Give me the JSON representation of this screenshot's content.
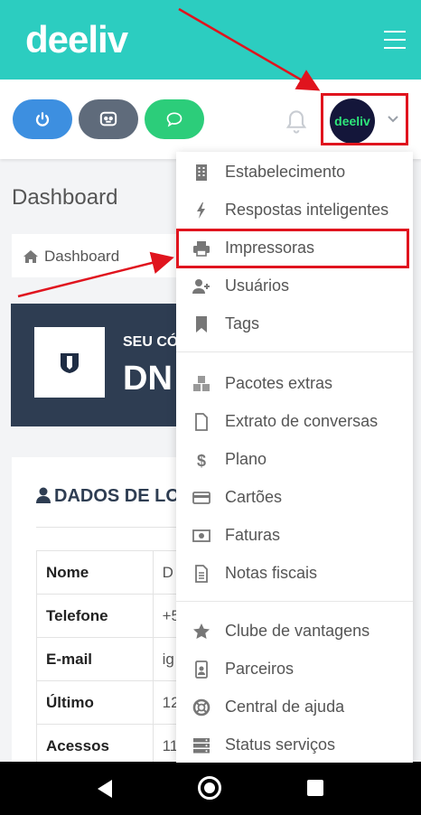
{
  "header": {
    "logo_text": "deeliv"
  },
  "user": {
    "avatar_text": "deeliv"
  },
  "page": {
    "title": "Dashboard",
    "breadcrumb": "Dashboard"
  },
  "banner": {
    "subtitle": "SEU CÓ",
    "code": "DN"
  },
  "card": {
    "title": "DADOS DE LO",
    "rows": [
      {
        "key": "Nome",
        "value": "D"
      },
      {
        "key": "Telefone",
        "value": "+5"
      },
      {
        "key": "E-mail",
        "value": "ig"
      },
      {
        "key": "Último",
        "value": "12"
      },
      {
        "key": "Acessos",
        "value": "11"
      }
    ]
  },
  "menu": {
    "items": [
      {
        "label": "Estabelecimento",
        "icon": "building-icon"
      },
      {
        "label": "Respostas inteligentes",
        "icon": "bolt-icon"
      },
      {
        "label": "Impressoras",
        "icon": "printer-icon"
      },
      {
        "label": "Usuários",
        "icon": "user-plus-icon"
      },
      {
        "label": "Tags",
        "icon": "bookmark-icon"
      },
      {
        "label": "Pacotes extras",
        "icon": "cubes-icon"
      },
      {
        "label": "Extrato de conversas",
        "icon": "file-icon"
      },
      {
        "label": "Plano",
        "icon": "dollar-icon"
      },
      {
        "label": "Cartões",
        "icon": "credit-card-icon"
      },
      {
        "label": "Faturas",
        "icon": "money-bill-icon"
      },
      {
        "label": "Notas fiscais",
        "icon": "file-text-icon"
      },
      {
        "label": "Clube de vantagens",
        "icon": "star-icon"
      },
      {
        "label": "Parceiros",
        "icon": "id-badge-icon"
      },
      {
        "label": "Central de ajuda",
        "icon": "life-ring-icon"
      },
      {
        "label": "Status serviços",
        "icon": "server-icon"
      }
    ]
  },
  "colors": {
    "teal": "#2ccdc0",
    "navy": "#2e3d52",
    "highlight": "#e0141e"
  }
}
